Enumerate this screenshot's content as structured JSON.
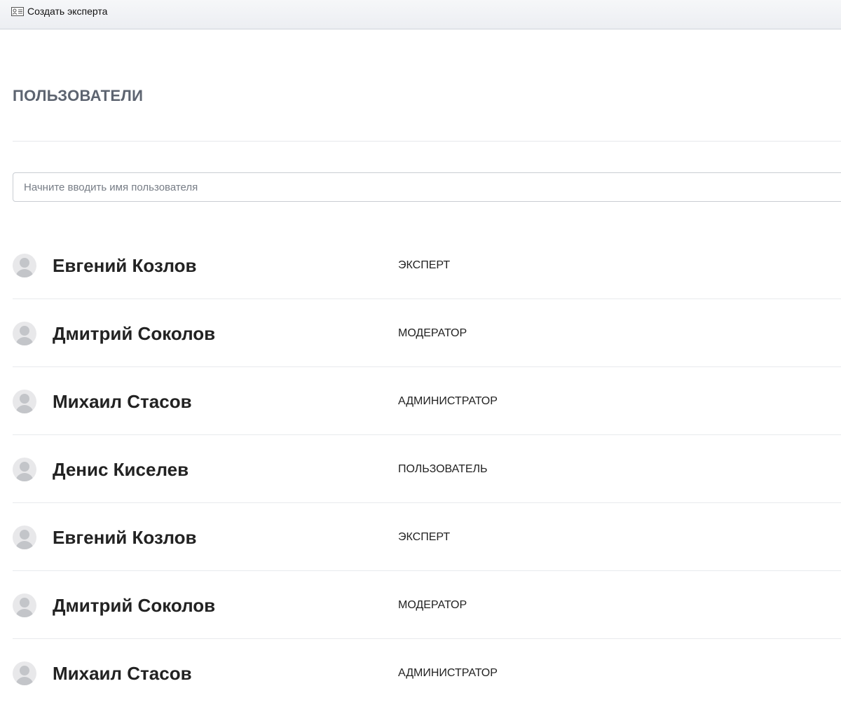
{
  "toolbar": {
    "create_expert_label": "Создать эксперта",
    "create_expert_icon": "id-card-icon"
  },
  "page": {
    "title": "ПОЛЬЗОВАТЕЛИ"
  },
  "search": {
    "placeholder": "Начните вводить имя пользователя",
    "value": ""
  },
  "users": [
    {
      "name": "Евгений Козлов",
      "role": "ЭКСПЕРТ"
    },
    {
      "name": "Дмитрий Соколов",
      "role": "МОДЕРАТОР"
    },
    {
      "name": "Михаил Стасов",
      "role": "АДМИНИСТРАТОР"
    },
    {
      "name": "Денис Киселев",
      "role": "ПОЛЬЗОВАТЕЛЬ"
    },
    {
      "name": "Евгений Козлов",
      "role": "ЭКСПЕРТ"
    },
    {
      "name": "Дмитрий Соколов",
      "role": "МОДЕРАТОР"
    },
    {
      "name": "Михаил Стасов",
      "role": "АДМИНИСТРАТОР"
    }
  ],
  "colors": {
    "title": "#5d6470",
    "avatar_bg": "#e8e8ea",
    "avatar_fg": "#c3c5c9",
    "divider": "#e8eaed"
  }
}
